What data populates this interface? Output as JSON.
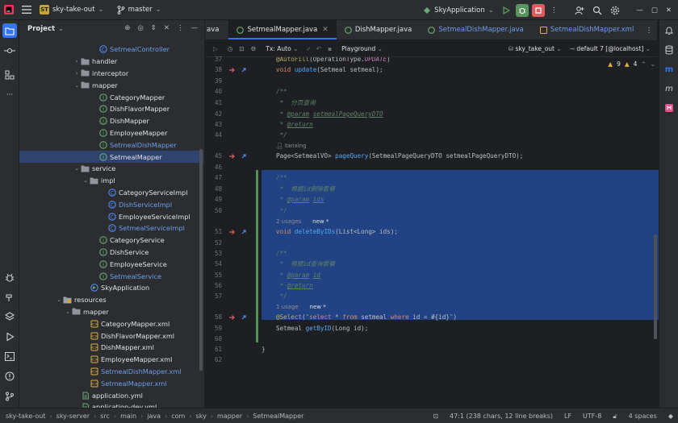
{
  "titlebar": {
    "project_badge": "ST",
    "project_name": "sky-take-out",
    "branch": "master",
    "run_config": "SkyApplication",
    "colors": {
      "run": "#57965c",
      "debug": "#57965c",
      "stop": "#e55b5b"
    }
  },
  "project_panel": {
    "title": "Project",
    "items": [
      {
        "label": "SetmealController",
        "depth": 8,
        "icon": "class",
        "color": "blue"
      },
      {
        "label": "handler",
        "depth": 6,
        "icon": "folder",
        "arrow": "›"
      },
      {
        "label": "interceptor",
        "depth": 6,
        "icon": "folder",
        "arrow": "›"
      },
      {
        "label": "mapper",
        "depth": 6,
        "icon": "folder",
        "arrow": "⌄"
      },
      {
        "label": "CategoryMapper",
        "depth": 8,
        "icon": "interface"
      },
      {
        "label": "DishFlavorMapper",
        "depth": 8,
        "icon": "interface"
      },
      {
        "label": "DishMapper",
        "depth": 8,
        "icon": "interface"
      },
      {
        "label": "EmployeeMapper",
        "depth": 8,
        "icon": "interface"
      },
      {
        "label": "SetmealDishMapper",
        "depth": 8,
        "icon": "interface",
        "color": "blue"
      },
      {
        "label": "SetmealMapper",
        "depth": 8,
        "icon": "interface",
        "selected": true
      },
      {
        "label": "service",
        "depth": 6,
        "icon": "folder",
        "arrow": "⌄"
      },
      {
        "label": "impl",
        "depth": 7,
        "icon": "folder",
        "arrow": "⌄"
      },
      {
        "label": "CategoryServiceImpl",
        "depth": 9,
        "icon": "class"
      },
      {
        "label": "DishServiceImpl",
        "depth": 9,
        "icon": "class",
        "color": "blue"
      },
      {
        "label": "EmployeeServiceImpl",
        "depth": 9,
        "icon": "class"
      },
      {
        "label": "SetmealServiceImpl",
        "depth": 9,
        "icon": "class",
        "color": "blue"
      },
      {
        "label": "CategoryService",
        "depth": 8,
        "icon": "service"
      },
      {
        "label": "DishService",
        "depth": 8,
        "icon": "service"
      },
      {
        "label": "EmployeeService",
        "depth": 8,
        "icon": "service"
      },
      {
        "label": "SetmealService",
        "depth": 8,
        "icon": "service",
        "color": "blue"
      },
      {
        "label": "SkyApplication",
        "depth": 7,
        "icon": "app"
      },
      {
        "label": "resources",
        "depth": 4,
        "icon": "resfolder",
        "arrow": "⌄"
      },
      {
        "label": "mapper",
        "depth": 5,
        "icon": "folder",
        "arrow": "⌄"
      },
      {
        "label": "CategoryMapper.xml",
        "depth": 7,
        "icon": "xml"
      },
      {
        "label": "DishFlavorMapper.xml",
        "depth": 7,
        "icon": "xml"
      },
      {
        "label": "DishMapper.xml",
        "depth": 7,
        "icon": "xml"
      },
      {
        "label": "EmployeeMapper.xml",
        "depth": 7,
        "icon": "xml"
      },
      {
        "label": "SetmealDishMapper.xml",
        "depth": 7,
        "icon": "xml",
        "color": "blue"
      },
      {
        "label": "SetmealMapper.xml",
        "depth": 7,
        "icon": "xml",
        "color": "blue"
      },
      {
        "label": "application.yml",
        "depth": 6,
        "icon": "yml"
      },
      {
        "label": "application-dev.yml",
        "depth": 6,
        "icon": "yml"
      }
    ]
  },
  "tabs": [
    {
      "label": "ava",
      "active": false
    },
    {
      "label": "SetmealMapper.java",
      "active": true,
      "closable": true
    },
    {
      "label": "DishMapper.java",
      "active": false
    },
    {
      "label": "SetmealDishMapper.java",
      "active": false,
      "color": "blue"
    },
    {
      "label": "SetmealDishMapper.xml",
      "active": false,
      "color": "blue"
    }
  ],
  "editor_toolbar": {
    "tx": "Tx: Auto",
    "playground": "Playground",
    "datasource": "sky_take_out",
    "schema": "default 7 [@localhost]",
    "warnings": "9",
    "weak_warnings": "4"
  },
  "line_numbers": [
    "37",
    "38",
    "39",
    "40",
    "41",
    "42",
    "43",
    "44",
    "",
    "45",
    "46",
    "47",
    "48",
    "49",
    "50",
    "",
    "51",
    "52",
    "53",
    "54",
    "55",
    "56",
    "57",
    "",
    "58",
    "59",
    "60",
    "61",
    "62"
  ],
  "code_lines": [
    "@AutoFill(OperationType.UPDATE)",
    "void update(Setmeal setmeal);",
    "",
    "/**",
    " *  分页查询",
    " * @param setmealPageQueryDTO",
    " * @return",
    " */",
    "tanxing",
    "Page<SetmealVO> pageQuery(SetmealPageQueryDTO setmealPageQueryDTO);",
    "",
    "/**",
    " *  根据id删除套餐",
    " * @param ids",
    " */",
    "2 usages   new *",
    "void deleteByIDs(List<Long> ids);",
    "",
    "/**",
    " *  根据id查询套餐",
    " * @param id",
    " * @return",
    " */",
    "1 usage   new *",
    "@Select(\"select * from setmeal where id = #{id}\")",
    "Setmeal getByID(Long id);",
    "",
    "}",
    ""
  ],
  "statusbar": {
    "crumbs": [
      "sky-take-out",
      "sky-server",
      "src",
      "main",
      "java",
      "com",
      "sky",
      "mapper",
      "SetmealMapper"
    ],
    "position": "47:1 (238 chars, 12 line breaks)",
    "line_sep": "LF",
    "encoding": "UTF-8",
    "indent": "4 spaces"
  }
}
